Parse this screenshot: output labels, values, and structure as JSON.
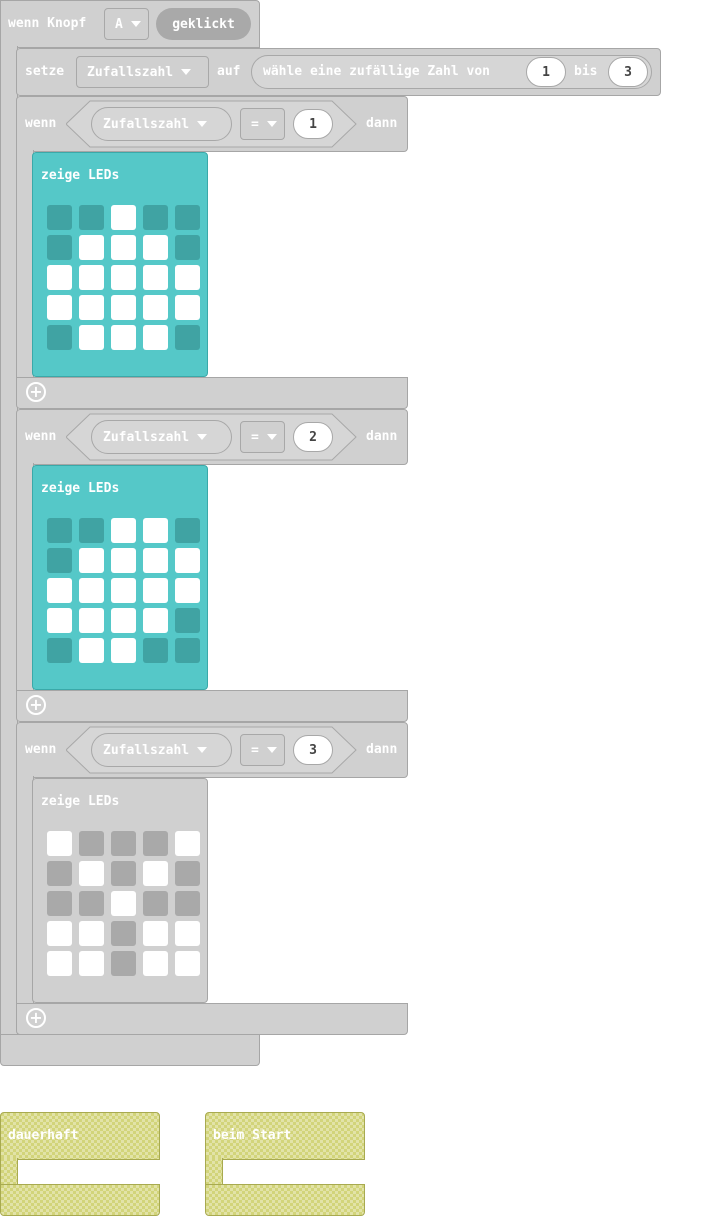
{
  "event": {
    "label": "wenn Knopf",
    "button": "A",
    "action": "geklickt"
  },
  "set": {
    "label": "setze",
    "variable": "Zufallszahl",
    "to": "auf",
    "random": {
      "label": "wähle eine zufällige Zahl von",
      "from": "1",
      "and": "bis",
      "to": "3"
    }
  },
  "ifs": [
    {
      "if_label": "wenn",
      "variable": "Zufallszahl",
      "op": "=",
      "value": "1",
      "then_label": "dann",
      "show": {
        "label": "zeige LEDs",
        "enabled": true,
        "leds": [
          [
            0,
            0,
            1,
            0,
            0
          ],
          [
            0,
            1,
            1,
            1,
            0
          ],
          [
            1,
            1,
            1,
            1,
            1
          ],
          [
            1,
            1,
            1,
            1,
            1
          ],
          [
            0,
            1,
            1,
            1,
            0
          ]
        ]
      }
    },
    {
      "if_label": "wenn",
      "variable": "Zufallszahl",
      "op": "=",
      "value": "2",
      "then_label": "dann",
      "show": {
        "label": "zeige LEDs",
        "enabled": true,
        "leds": [
          [
            0,
            0,
            1,
            1,
            0
          ],
          [
            0,
            1,
            1,
            1,
            1
          ],
          [
            1,
            1,
            1,
            1,
            1
          ],
          [
            1,
            1,
            1,
            1,
            0
          ],
          [
            0,
            1,
            1,
            0,
            0
          ]
        ]
      }
    },
    {
      "if_label": "wenn",
      "variable": "Zufallszahl",
      "op": "=",
      "value": "3",
      "then_label": "dann",
      "show": {
        "label": "zeige LEDs",
        "enabled": false,
        "leds": [
          [
            1,
            0,
            0,
            0,
            1
          ],
          [
            0,
            1,
            0,
            1,
            0
          ],
          [
            0,
            0,
            1,
            0,
            0
          ],
          [
            1,
            1,
            0,
            1,
            1
          ],
          [
            1,
            1,
            0,
            1,
            1
          ]
        ]
      }
    }
  ],
  "forever": {
    "label": "dauerhaft"
  },
  "on_start": {
    "label": "beim Start"
  },
  "colors": {
    "block_gray": "#d0d0d0",
    "led_teal": "#55c8c8",
    "led_off_teal": "#40a3a3",
    "led_off_gray": "#a9a9a9",
    "led_on": "#ffffff",
    "hat_yellow": "#d2d47a"
  }
}
